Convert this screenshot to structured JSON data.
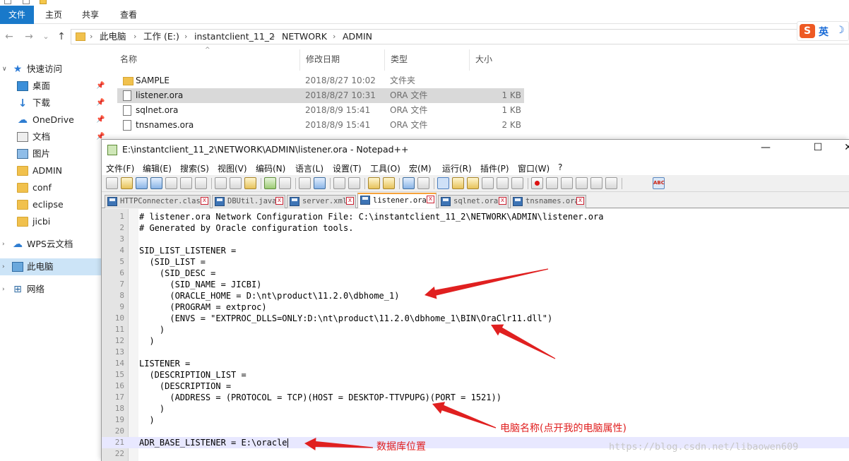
{
  "explorer": {
    "ribbon_tabs": [
      "文件",
      "主页",
      "共享",
      "查看"
    ],
    "nav": {
      "back": "←",
      "forward": "→",
      "dropdown": "⌄",
      "up": "↑"
    },
    "breadcrumb": [
      "此电脑",
      "工作 (E:)",
      "instantclient_11_2",
      "NETWORK",
      "ADMIN"
    ],
    "ime": {
      "logo": "S",
      "mode": "英",
      "moon": "☽"
    },
    "sidebar": [
      {
        "label": "快速访问",
        "icon": "star-icon",
        "top": true
      },
      {
        "label": "桌面",
        "icon": "desktop-icon",
        "pinned": true
      },
      {
        "label": "下载",
        "icon": "download-icon",
        "pinned": true
      },
      {
        "label": "OneDrive",
        "icon": "cloud-icon",
        "pinned": true
      },
      {
        "label": "文档",
        "icon": "document-icon",
        "pinned": true
      },
      {
        "label": "图片",
        "icon": "picture-icon",
        "pinned": true
      },
      {
        "label": "ADMIN",
        "icon": "folder-icon"
      },
      {
        "label": "conf",
        "icon": "folder-icon"
      },
      {
        "label": "eclipse",
        "icon": "folder-icon"
      },
      {
        "label": "jicbi",
        "icon": "folder-icon"
      },
      {
        "label": "WPS云文档",
        "icon": "cloud-icon",
        "top": true
      },
      {
        "label": "此电脑",
        "icon": "computer-icon",
        "top": true,
        "selected": true
      },
      {
        "label": "网络",
        "icon": "network-icon",
        "top": true
      }
    ],
    "columns": {
      "name": "名称",
      "date": "修改日期",
      "type": "类型",
      "size": "大小"
    },
    "files": [
      {
        "name": "SAMPLE",
        "date": "2018/8/27 10:02",
        "type": "文件夹",
        "size": "",
        "dir": true
      },
      {
        "name": "listener.ora",
        "date": "2018/8/27 10:31",
        "type": "ORA 文件",
        "size": "1 KB",
        "selected": true
      },
      {
        "name": "sqlnet.ora",
        "date": "2018/8/9 15:41",
        "type": "ORA 文件",
        "size": "1 KB"
      },
      {
        "name": "tnsnames.ora",
        "date": "2018/8/9 15:41",
        "type": "ORA 文件",
        "size": "2 KB"
      }
    ]
  },
  "notepad": {
    "title": "E:\\instantclient_11_2\\NETWORK\\ADMIN\\listener.ora - Notepad++",
    "window_controls": {
      "minimize": "—",
      "maximize": "☐",
      "close": "✕"
    },
    "menu": [
      "文件(F)",
      "编辑(E)",
      "搜索(S)",
      "视图(V)",
      "编码(N)",
      "语言(L)",
      "设置(T)",
      "工具(O)",
      "宏(M)",
      "运行(R)",
      "插件(P)",
      "窗口(W)",
      "?"
    ],
    "tabs": [
      {
        "label": "HTTPConnecter.class"
      },
      {
        "label": "DBUtil.java"
      },
      {
        "label": "server.xml"
      },
      {
        "label": "listener.ora",
        "active": true
      },
      {
        "label": "sqlnet.ora"
      },
      {
        "label": "tnsnames.ora"
      }
    ],
    "lines": [
      "# listener.ora Network Configuration File: C:\\instantclient_11_2\\NETWORK\\ADMIN\\listener.ora",
      "# Generated by Oracle configuration tools.",
      "",
      "SID_LIST_LISTENER =",
      "  (SID_LIST =",
      "    (SID_DESC =",
      "      (SID_NAME = JICBI)",
      "      (ORACLE_HOME = D:\\nt\\product\\11.2.0\\dbhome_1)",
      "      (PROGRAM = extproc)",
      "      (ENVS = \"EXTPROC_DLLS=ONLY:D:\\nt\\product\\11.2.0\\dbhome_1\\BIN\\OraClr11.dll\")",
      "    )",
      "  )",
      "",
      "LISTENER =",
      "  (DESCRIPTION_LIST =",
      "    (DESCRIPTION =",
      "      (ADDRESS = (PROTOCOL = TCP)(HOST = DESKTOP-TTVPUPG)(PORT = 1521))",
      "    )",
      "  )",
      "",
      "ADR_BASE_LISTENER = E:\\oracle",
      ""
    ],
    "current_line": 21
  },
  "annotations": {
    "computer_name_note": "电脑名称(点开我的电脑属性)",
    "db_location_note": "数据库位置",
    "arrow_color": "#e02020"
  },
  "watermark": "https://blog.csdn.net/libaowen609"
}
